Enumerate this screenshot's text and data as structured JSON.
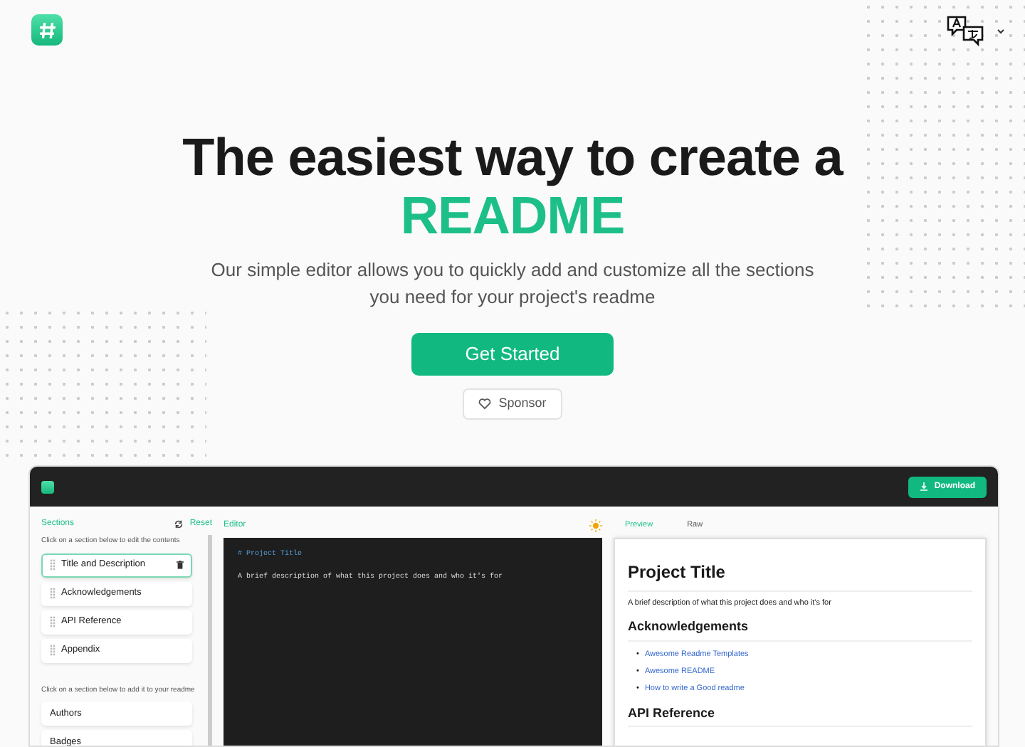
{
  "hero": {
    "title": "The easiest way to create a",
    "highlight": "README",
    "subtitle": "Our simple editor allows you to quickly add and customize all the sections you need for your project's readme",
    "cta": "Get Started",
    "sponsor": "Sponsor"
  },
  "app": {
    "download": "Download",
    "sections": {
      "label": "Sections",
      "reset": "Reset",
      "edit_hint": "Click on a section below to edit the contents",
      "items": [
        {
          "label": "Title and Description",
          "selected": true
        },
        {
          "label": "Acknowledgements",
          "selected": false
        },
        {
          "label": "API Reference",
          "selected": false
        },
        {
          "label": "Appendix",
          "selected": false
        }
      ],
      "add_hint": "Click on a section below to add it to your readme",
      "available": [
        "Authors",
        "Badges"
      ]
    },
    "editor": {
      "label": "Editor",
      "lines": [
        {
          "kind": "heading",
          "text": "# Project Title"
        },
        {
          "kind": "text",
          "text": "A brief description of what this project does and who it's for"
        }
      ]
    },
    "preview": {
      "tabs": [
        {
          "label": "Preview",
          "selected": true
        },
        {
          "label": "Raw",
          "selected": false
        }
      ],
      "title": "Project Title",
      "description": "A brief description of what this project does and who it's for",
      "h2": "Acknowledgements",
      "links": [
        {
          "bullet": "•",
          "text": "Awesome Readme Templates"
        },
        {
          "bullet": "•",
          "text": "Awesome README"
        },
        {
          "bullet": "•",
          "text": "How to write a Good readme"
        }
      ],
      "h2b": "API Reference"
    }
  }
}
